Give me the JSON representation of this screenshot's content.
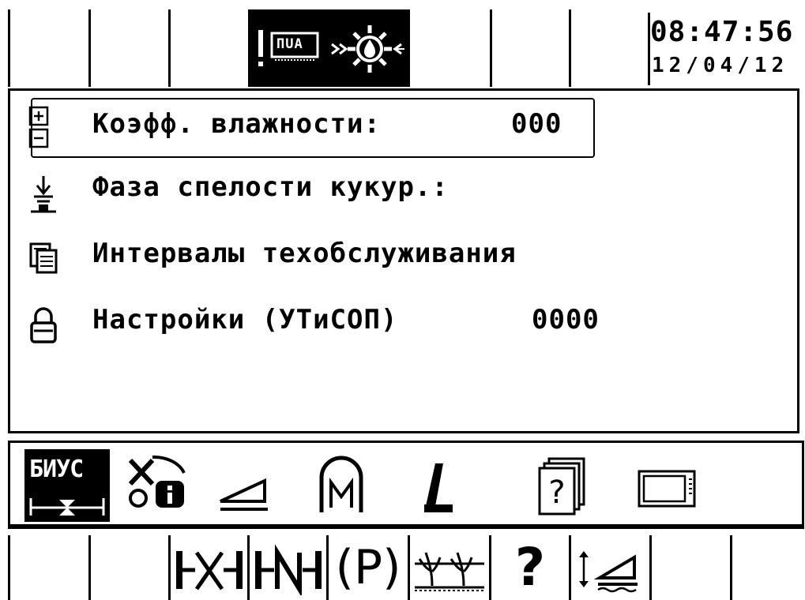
{
  "header": {
    "time": "08:47:56",
    "date": "12/04/12",
    "status_icons": [
      "warning-exclamation-icon",
      "pua-module-icon",
      "hydraulic-gear-icon"
    ],
    "status_label": "ПUA"
  },
  "menu": {
    "items": [
      {
        "icon": "plus-minus-icon",
        "label": "Коэфф. влажности:",
        "value": "000",
        "selected": true
      },
      {
        "icon": "corn-ripeness-icon",
        "label": "Фаза спелости кукур.:",
        "value": "",
        "selected": false
      },
      {
        "icon": "service-document-icon",
        "label": "Интервалы техобслуживания",
        "value": "",
        "selected": false
      },
      {
        "icon": "lock-icon",
        "label": "Настройки (УТиСОП)",
        "value": "0000",
        "selected": false
      }
    ]
  },
  "tabs": [
    {
      "icon": "biys-tab-icon",
      "label": "БИУС",
      "active": true
    },
    {
      "icon": "info-settings-tab-icon",
      "active": false
    },
    {
      "icon": "slope-tab-icon",
      "active": false
    },
    {
      "icon": "motor-tab-icon",
      "active": false
    },
    {
      "icon": "length-tab-icon",
      "active": false
    },
    {
      "icon": "help-document-tab-icon",
      "active": false
    },
    {
      "icon": "display-tab-icon",
      "active": false
    }
  ],
  "softkeys": [
    {
      "icon": "empty"
    },
    {
      "icon": "empty"
    },
    {
      "icon": "cut-width-x-icon",
      "label": "⊢X⊣"
    },
    {
      "icon": "cut-width-n-icon",
      "label": "⊢N⊣"
    },
    {
      "icon": "p-in-parentheses-icon",
      "label": "(P)"
    },
    {
      "icon": "crop-height-icon"
    },
    {
      "icon": "help-icon",
      "label": "?"
    },
    {
      "icon": "slope-adjust-icon"
    },
    {
      "icon": "empty"
    }
  ]
}
